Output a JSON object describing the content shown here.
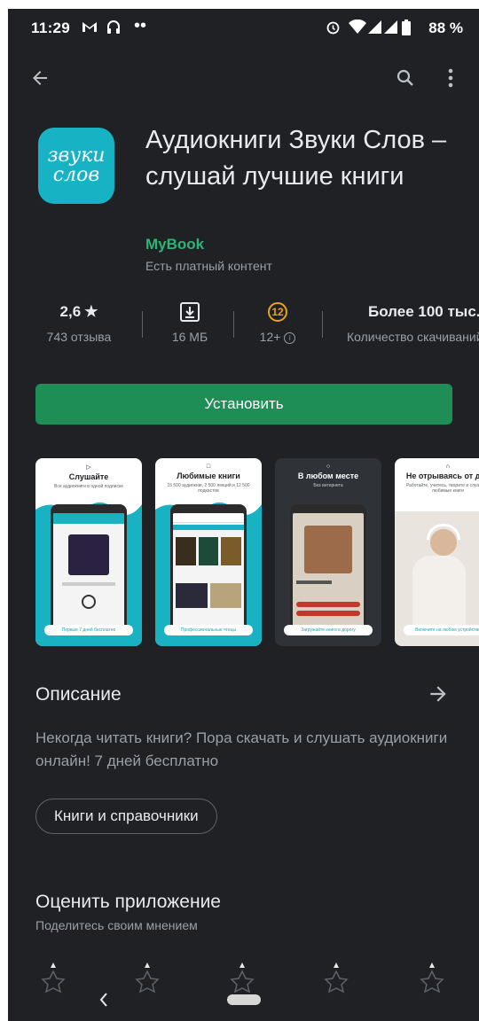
{
  "status_bar": {
    "time": "11:29",
    "battery": "88 %"
  },
  "toolbar": {
    "back_icon": "arrow-left-icon",
    "search_icon": "search-icon",
    "menu_icon": "more-vert-icon"
  },
  "app": {
    "icon_text_line1": "звуки",
    "icon_text_line2": "слов",
    "title": "Аудиокниги Звуки Слов – слушай лучшие книги",
    "developer": "MyBook",
    "paid_content": "Есть платный контент",
    "accent_color": "#1e8e56"
  },
  "stats": {
    "rating": "2,6",
    "rating_star": "★",
    "reviews": "743 отзыва",
    "size": "16 МБ",
    "age_badge": "12",
    "age_label": "12+",
    "downloads": "Более 100 тыс.",
    "downloads_label": "Количество скачиваний"
  },
  "install_label": "Установить",
  "screenshots": [
    {
      "caption": "Слушайте",
      "sub": "Все аудиокниги в одной подписке",
      "button": "Первые 7 дней бесплатно"
    },
    {
      "caption": "Любимые книги",
      "sub": "15 500 аудиокниг, 2 500 лекций и 12 500 подкастов",
      "button": "Профессиональные чтецы"
    },
    {
      "caption": "В любом месте",
      "sub": "Без интернета",
      "button": "Загружайте книги в дорогу"
    },
    {
      "caption": "Не отрываясь от дел",
      "sub": "Работайте, учитесь, творите и слушайте любимые книги",
      "button": "Включите на любом устройстве"
    }
  ],
  "description": {
    "title": "Описание",
    "text": "Некогда читать книги? Пора скачать и слушать аудиокниги онлайн! 7 дней бесплатно",
    "category": "Книги и справочники"
  },
  "rate": {
    "title": "Оценить приложение",
    "subtitle": "Поделитесь своим мнением",
    "stars": 5
  }
}
